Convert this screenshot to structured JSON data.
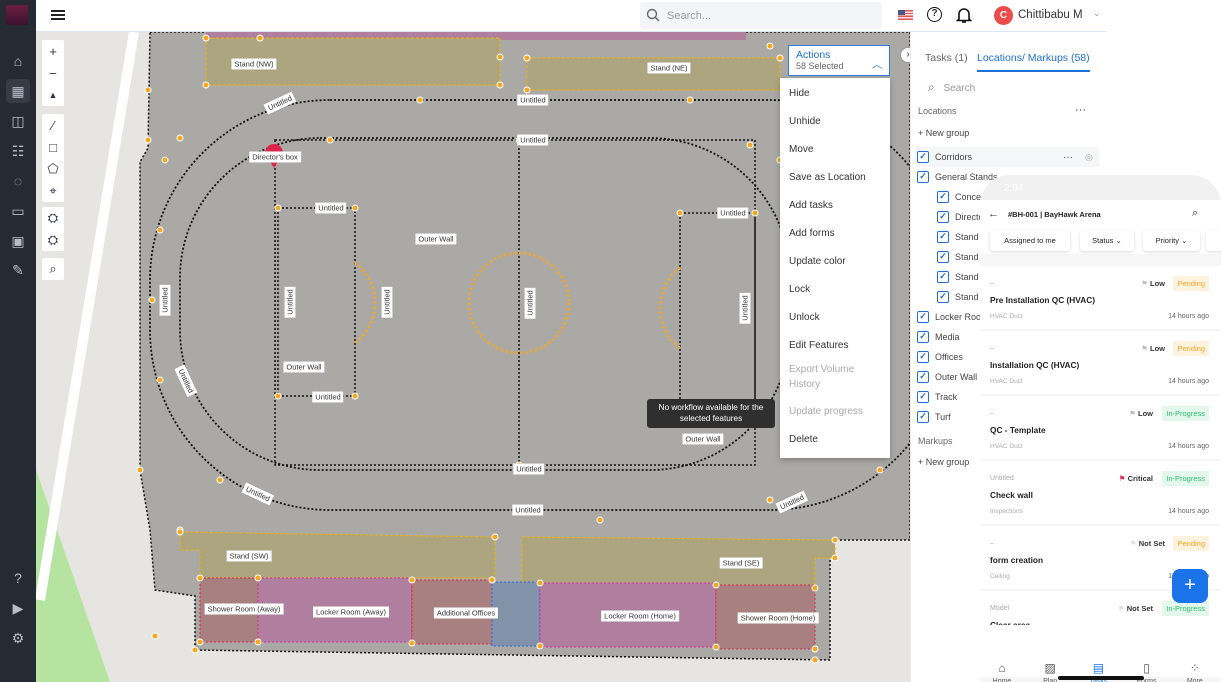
{
  "topbar": {
    "search_placeholder": "Search...",
    "user_initial": "C",
    "user_name": "Chittibabu M"
  },
  "map": {
    "labels": [
      "Stand (NW)",
      "Stand (NE)",
      "Untitled",
      "Untitled",
      "Untitled",
      "Director's box",
      "Untitled",
      "Outer Wall",
      "Untitled",
      "Untitled",
      "Untitled",
      "Untitled",
      "Untitled",
      "Untitled",
      "Untitled",
      "Outer Wall",
      "Untitled",
      "Outer Wall",
      "Untitled",
      "Untitled",
      "Untitled",
      "Untitled",
      "Stand (SW)",
      "Stand (SE)",
      "Shower Room (Away)",
      "Locker Room (Away)",
      "Additional Offices",
      "Locker Room (Home)",
      "Shower Room (Home)"
    ],
    "colors": {
      "stand": "#ada57f",
      "locker": "#b07f9f",
      "shower": "#a8807f",
      "blue_room": "#8292a8",
      "structure": "#aaa9a5",
      "vertex": "#f5a623"
    }
  },
  "actions": {
    "title": "Actions",
    "subtitle": "58 Selected",
    "items": [
      {
        "label": "Hide",
        "disabled": false
      },
      {
        "label": "Unhide",
        "disabled": false
      },
      {
        "label": "Move",
        "disabled": false
      },
      {
        "label": "Save as Location",
        "disabled": false
      },
      {
        "label": "Add tasks",
        "disabled": false
      },
      {
        "label": "Add forms",
        "disabled": false
      },
      {
        "label": "Update color",
        "disabled": false
      },
      {
        "label": "Lock",
        "disabled": false
      },
      {
        "label": "Unlock",
        "disabled": false
      },
      {
        "label": "Edit Features",
        "disabled": false
      },
      {
        "label": "Export Volume History",
        "disabled": true
      },
      {
        "label": "Update progress",
        "disabled": true
      },
      {
        "label": "Delete",
        "disabled": false
      }
    ]
  },
  "tooltip": "No workflow available for the selected features",
  "panel": {
    "tabs": [
      {
        "label": "Tasks (1)",
        "active": false
      },
      {
        "label": "Locations/ Markups (58)",
        "active": true
      }
    ],
    "search_placeholder": "Search",
    "locations_heading": "Locations",
    "new_group": "+ New group",
    "markups_heading": "Markups",
    "items": [
      {
        "label": "Corridors",
        "checked": true,
        "level": 0
      },
      {
        "label": "General Stands",
        "checked": true,
        "level": 0
      },
      {
        "label": "Conces",
        "checked": true,
        "level": 1
      },
      {
        "label": "Directo",
        "checked": true,
        "level": 1
      },
      {
        "label": "Stand",
        "checked": true,
        "level": 1
      },
      {
        "label": "Stand",
        "checked": true,
        "level": 1
      },
      {
        "label": "Stand",
        "checked": true,
        "level": 1
      },
      {
        "label": "Stand",
        "checked": true,
        "level": 1
      },
      {
        "label": "Locker Room",
        "checked": true,
        "level": 0
      },
      {
        "label": "Media",
        "checked": true,
        "level": 0
      },
      {
        "label": "Offices",
        "checked": true,
        "level": 0
      },
      {
        "label": "Outer Wall",
        "checked": true,
        "level": 0
      },
      {
        "label": "Track",
        "checked": true,
        "level": 0
      },
      {
        "label": "Turf",
        "checked": true,
        "level": 0
      }
    ]
  },
  "mobile": {
    "time": "2:04",
    "title": "#BH-001 | BayHawk Arena",
    "filters": [
      "Assigned to me",
      "Status",
      "Priority"
    ],
    "tasks": [
      {
        "location": "–",
        "title": "Pre Installation QC (HVAC)",
        "category": "HVAC Duct",
        "time": "14 hours ago",
        "priority": "Low",
        "status": "Pending"
      },
      {
        "location": "–",
        "title": "Installation QC (HVAC)",
        "category": "HVAC Duct",
        "time": "14 hours ago",
        "priority": "Low",
        "status": "Pending"
      },
      {
        "location": "–",
        "title": "QC - Template",
        "category": "HVAC Duct",
        "time": "14 hours ago",
        "priority": "Low",
        "status": "In-Progress"
      },
      {
        "location": "Untitled",
        "title": "Check wall",
        "category": "Inspections",
        "time": "14 hours ago",
        "priority": "Critical",
        "status": "In-Progress"
      },
      {
        "location": "–",
        "title": "form creation",
        "category": "Ceiling",
        "time": "14 hours ago",
        "priority": "Not Set",
        "status": "Pending"
      },
      {
        "location": "Model",
        "title": "Clear area",
        "category": "",
        "time": "",
        "priority": "Not Set",
        "status": "In-Progress"
      }
    ],
    "nav": [
      {
        "label": "Home",
        "active": false
      },
      {
        "label": "Plan",
        "active": false
      },
      {
        "label": "Tasks",
        "active": true
      },
      {
        "label": "Forms",
        "active": false
      },
      {
        "label": "More",
        "active": false
      }
    ],
    "fab": "+",
    "accent": "#1a73e8"
  }
}
